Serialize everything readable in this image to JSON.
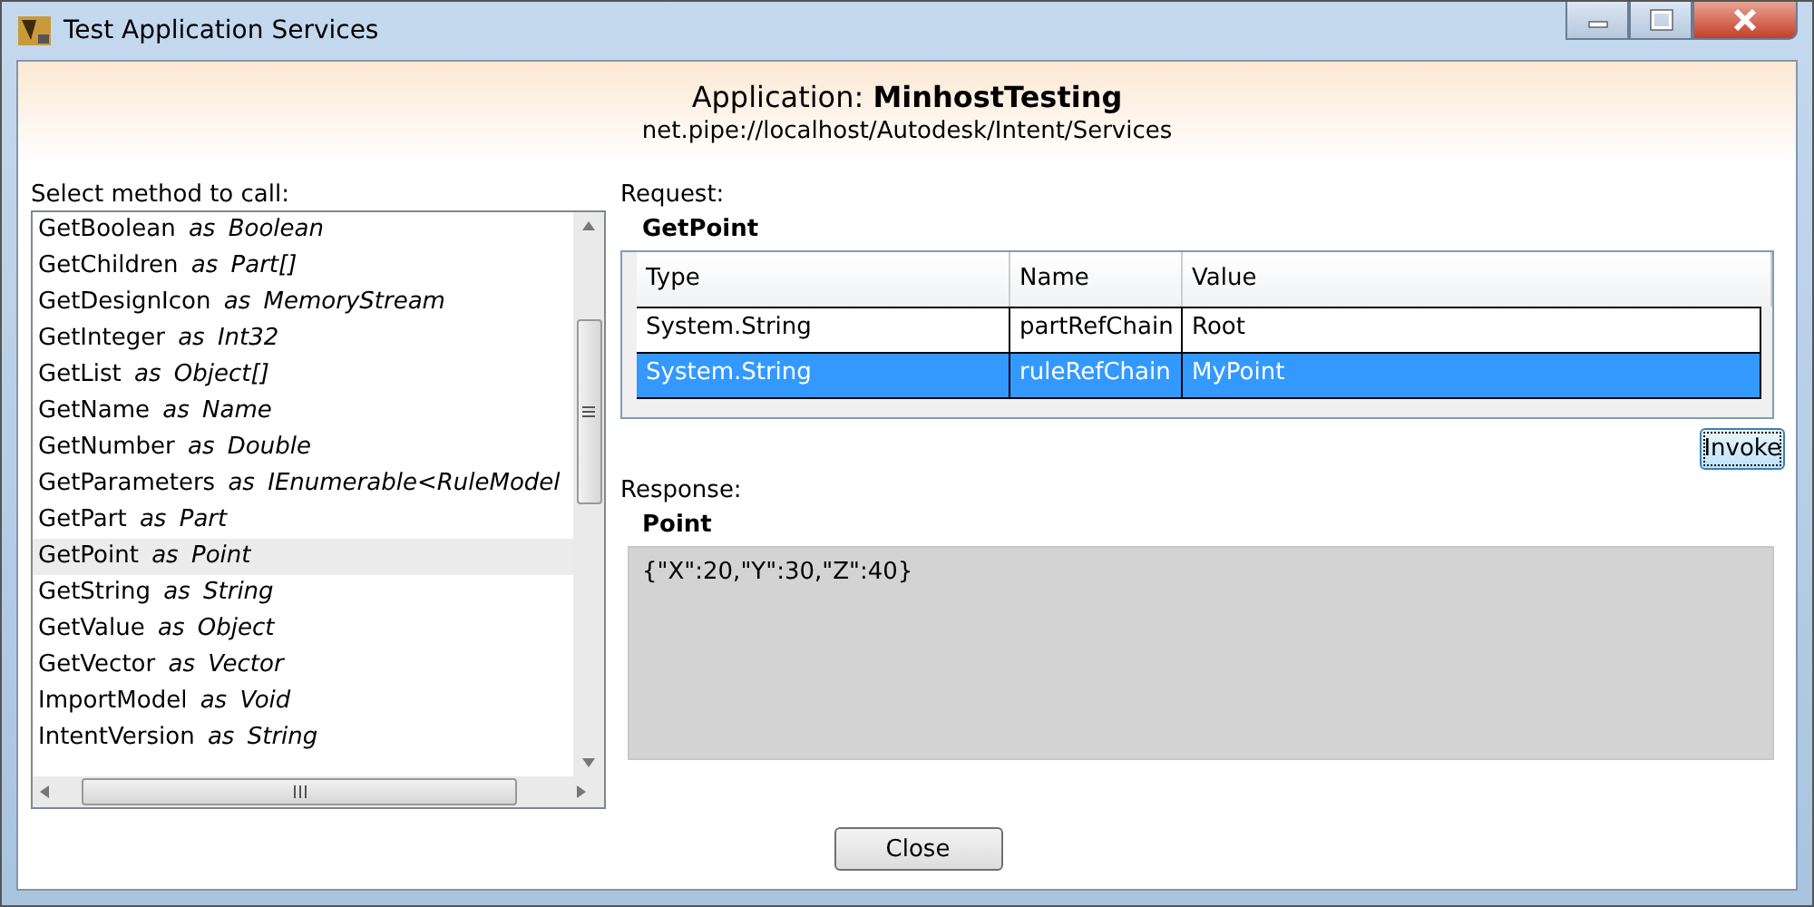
{
  "window": {
    "title": "Test Application Services"
  },
  "header": {
    "label": "Application:",
    "app_name": "MinhostTesting",
    "url": "net.pipe://localhost/Autodesk/Intent/Services"
  },
  "methods": {
    "label": "Select method to call:",
    "items": [
      {
        "name": "GetBoolean",
        "as": "as",
        "type": "Boolean",
        "selected": false
      },
      {
        "name": "GetChildren",
        "as": "as",
        "type": "Part[]",
        "selected": false
      },
      {
        "name": "GetDesignIcon",
        "as": "as",
        "type": "MemoryStream",
        "selected": false
      },
      {
        "name": "GetInteger",
        "as": "as",
        "type": "Int32",
        "selected": false
      },
      {
        "name": "GetList",
        "as": "as",
        "type": "Object[]",
        "selected": false
      },
      {
        "name": "GetName",
        "as": "as",
        "type": "Name",
        "selected": false
      },
      {
        "name": "GetNumber",
        "as": "as",
        "type": "Double",
        "selected": false
      },
      {
        "name": "GetParameters",
        "as": "as",
        "type": "IEnumerable<RuleModel",
        "selected": false
      },
      {
        "name": "GetPart",
        "as": "as",
        "type": "Part",
        "selected": false
      },
      {
        "name": "GetPoint",
        "as": "as",
        "type": "Point",
        "selected": true
      },
      {
        "name": "GetString",
        "as": "as",
        "type": "String",
        "selected": false
      },
      {
        "name": "GetValue",
        "as": "as",
        "type": "Object",
        "selected": false
      },
      {
        "name": "GetVector",
        "as": "as",
        "type": "Vector",
        "selected": false
      },
      {
        "name": "ImportModel",
        "as": "as",
        "type": "Void",
        "selected": false
      },
      {
        "name": "IntentVersion",
        "as": "as",
        "type": "String",
        "selected": false
      }
    ]
  },
  "request": {
    "label": "Request:",
    "method": "GetPoint",
    "columns": [
      "Type",
      "Name",
      "Value"
    ],
    "rows": [
      {
        "type": "System.String",
        "name": "partRefChain",
        "value": "Root",
        "selected": false
      },
      {
        "type": "System.String",
        "name": "ruleRefChain",
        "value": "MyPoint",
        "selected": true
      }
    ]
  },
  "invoke_button": "Invoke",
  "response": {
    "label": "Response:",
    "type": "Point",
    "value": "{\"X\":20,\"Y\":30,\"Z\":40}"
  },
  "close_button": "Close"
}
